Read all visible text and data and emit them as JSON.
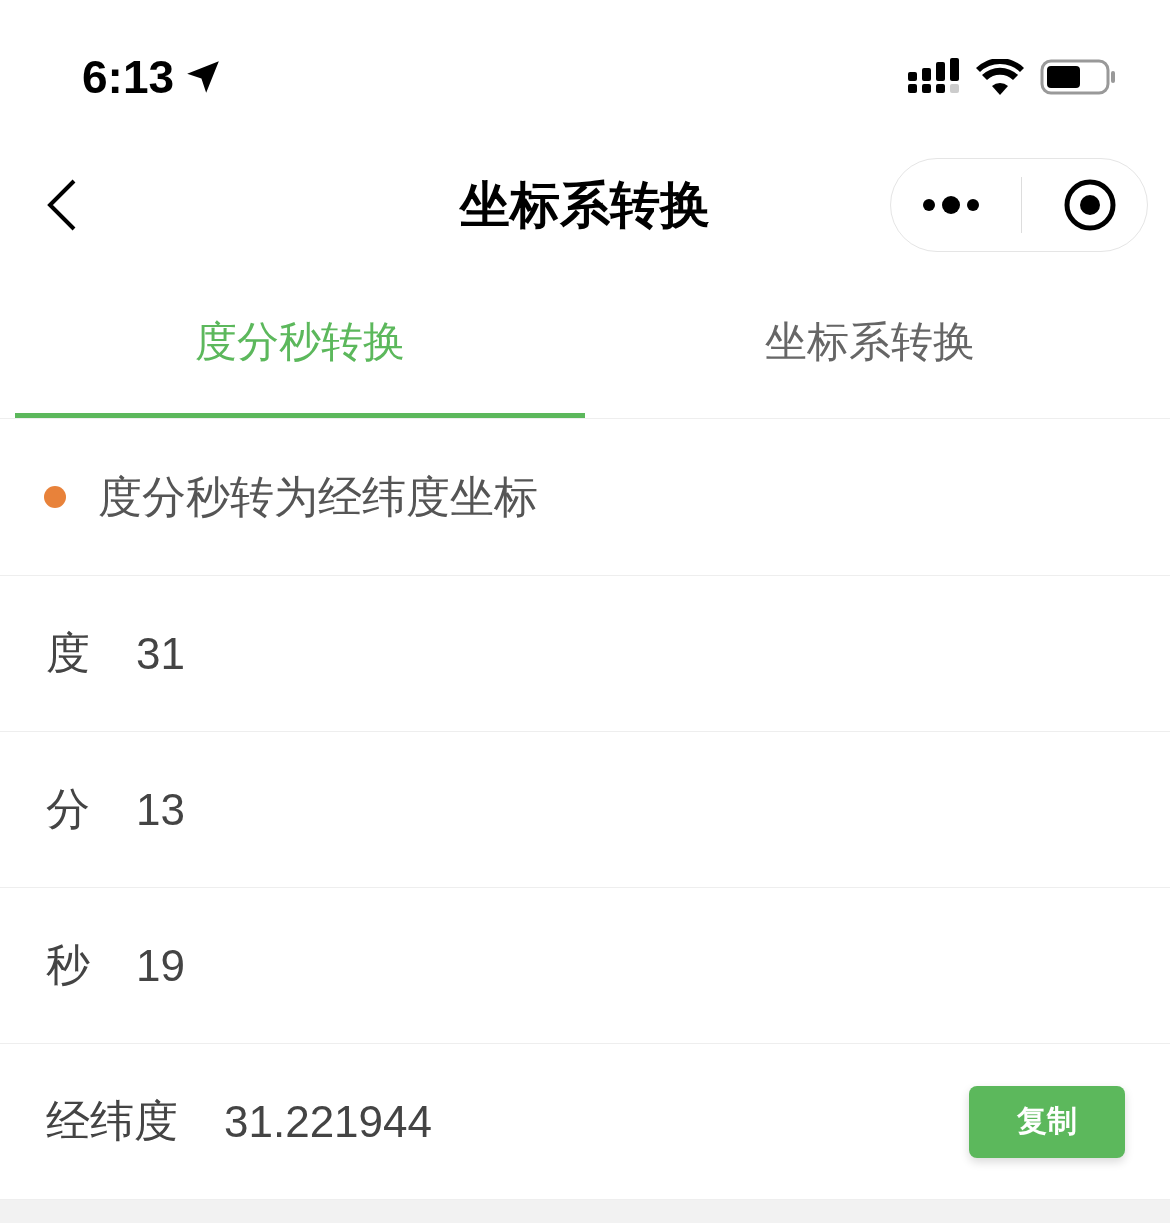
{
  "status_bar": {
    "time": "6:13"
  },
  "nav_bar": {
    "title": "坐标系转换"
  },
  "tabs": [
    {
      "label": "度分秒转换",
      "selected": true
    },
    {
      "label": "坐标系转换",
      "selected": false
    }
  ],
  "section": {
    "title": "度分秒转为经纬度坐标",
    "color": "#e8823a"
  },
  "fields": [
    {
      "label": "度",
      "value": "31"
    },
    {
      "label": "分",
      "value": "13"
    },
    {
      "label": "秒",
      "value": "19"
    }
  ],
  "result": {
    "label": "经纬度",
    "value": "31.221944",
    "button": "复制"
  }
}
